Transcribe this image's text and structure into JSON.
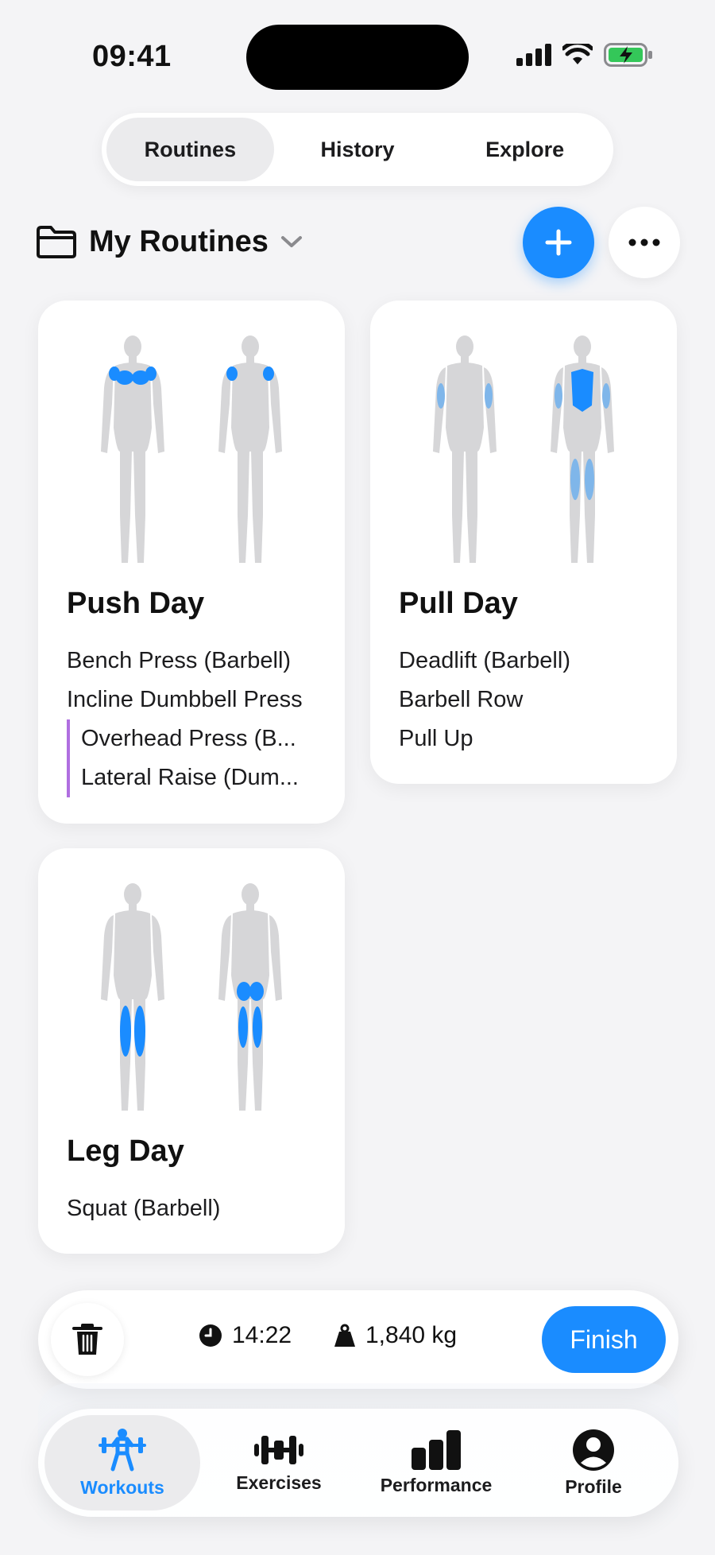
{
  "status_bar": {
    "time": "09:41"
  },
  "segments": [
    {
      "label": "Routines",
      "active": true
    },
    {
      "label": "History",
      "active": false
    },
    {
      "label": "Explore",
      "active": false
    }
  ],
  "section": {
    "title": "My Routines"
  },
  "routines": [
    {
      "title": "Push Day",
      "exercises": [
        "Bench Press (Barbell)",
        "Incline Dumbbell Press",
        "Overhead Press (B...",
        "Lateral Raise (Dum..."
      ],
      "highlight": [
        "chest",
        "shoulders"
      ]
    },
    {
      "title": "Pull Day",
      "exercises": [
        "Deadlift (Barbell)",
        "Barbell Row",
        "Pull Up"
      ],
      "highlight": [
        "back",
        "hamstrings",
        "arms"
      ]
    },
    {
      "title": "Leg Day",
      "exercises": [
        "Squat (Barbell)"
      ],
      "highlight": [
        "quads",
        "glutes",
        "hamstrings"
      ]
    }
  ],
  "workout": {
    "duration": "14:22",
    "volume": "1,840 kg",
    "finish_label": "Finish"
  },
  "tabs": [
    {
      "label": "Workouts",
      "icon": "weightlifter-icon",
      "active": true
    },
    {
      "label": "Exercises",
      "icon": "dumbbell-icon",
      "active": false
    },
    {
      "label": "Performance",
      "icon": "bar-chart-icon",
      "active": false
    },
    {
      "label": "Profile",
      "icon": "person-circle-icon",
      "active": false
    }
  ],
  "colors": {
    "accent": "#1a8cff",
    "muscle_primary": "#1a8cff",
    "muscle_secondary": "#7fb6ea",
    "body": "#d6d6d8",
    "marker": "#b06fe0"
  }
}
